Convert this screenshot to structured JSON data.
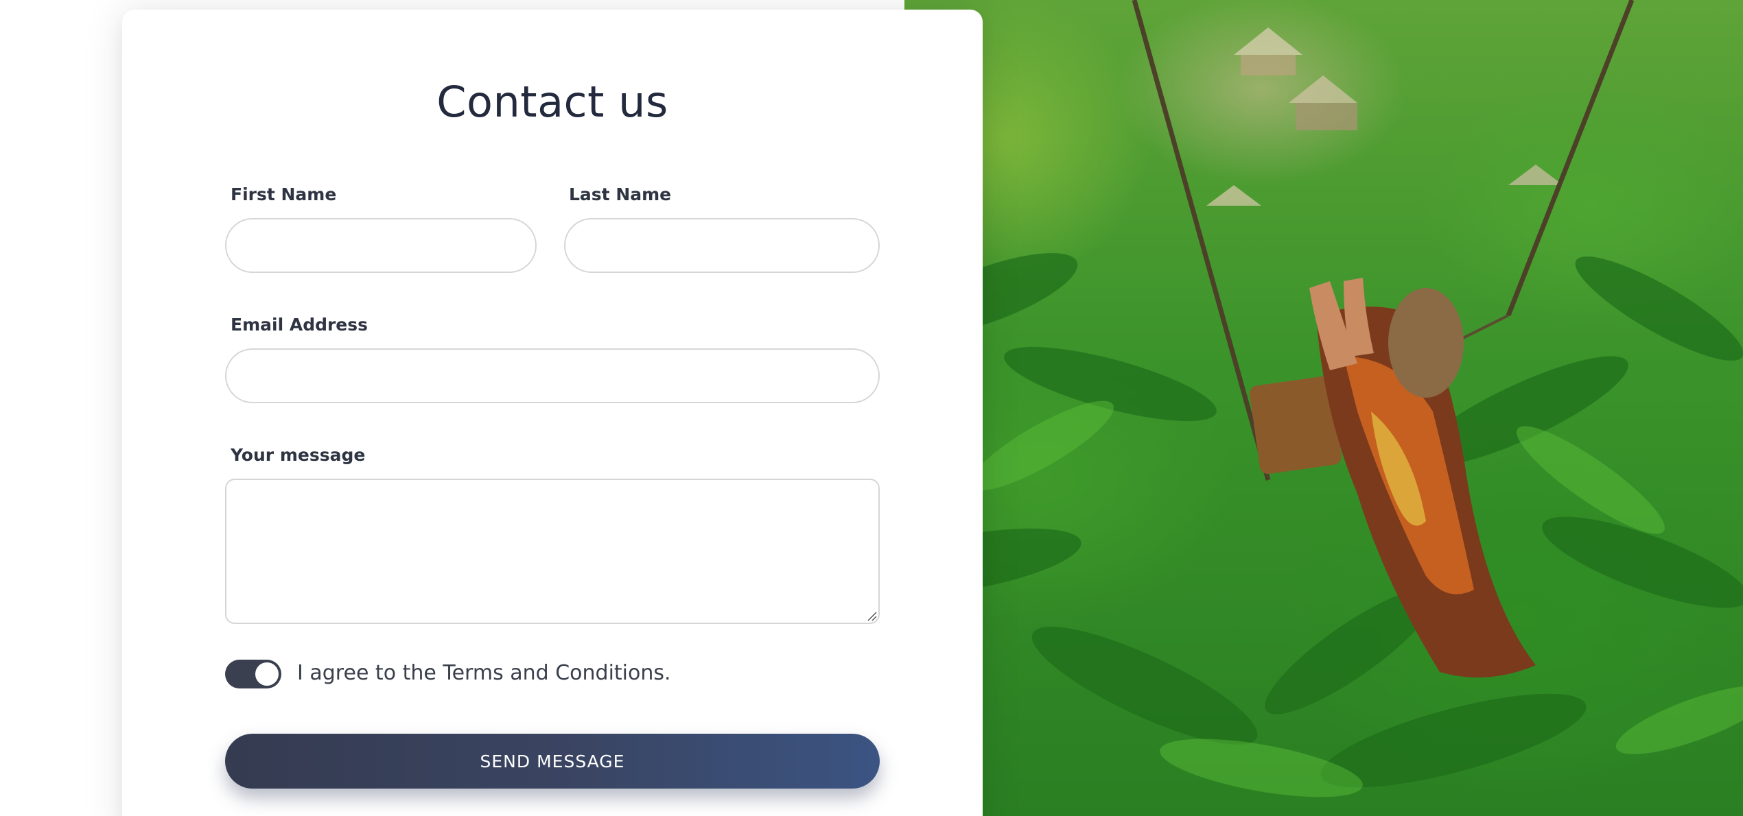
{
  "form": {
    "title": "Contact us",
    "first_name": {
      "label": "First Name",
      "value": "",
      "placeholder": ""
    },
    "last_name": {
      "label": "Last Name",
      "value": "",
      "placeholder": ""
    },
    "email": {
      "label": "Email Address",
      "value": "",
      "placeholder": ""
    },
    "message": {
      "label": "Your message",
      "value": "",
      "placeholder": ""
    },
    "terms": {
      "label": "I agree to the Terms and Conditions.",
      "checked": true
    },
    "submit_label": "SEND MESSAGE"
  },
  "colors": {
    "heading": "#232a3d",
    "toggle_on": "#3a4050",
    "button_start": "#353b50",
    "button_end": "#3b5482",
    "input_border": "#d6d6d6"
  },
  "hero_image": {
    "icon": "jungle-swing-photo"
  }
}
